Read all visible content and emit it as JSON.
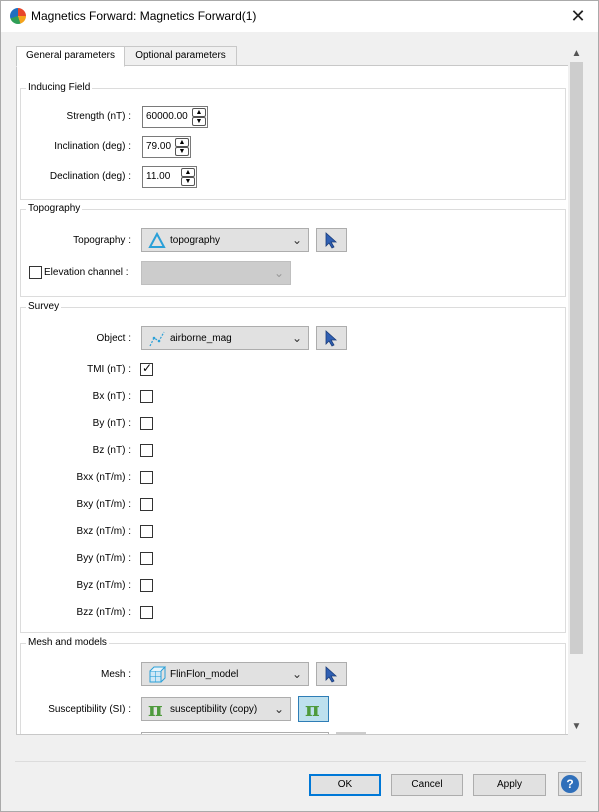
{
  "window": {
    "title": "Magnetics Forward: Magnetics Forward(1)",
    "close_glyph": "✕"
  },
  "tabs": [
    {
      "label": "General parameters",
      "active": true
    },
    {
      "label": "Optional parameters",
      "active": false
    }
  ],
  "inducing_field": {
    "title": "Inducing Field",
    "strength_label": "Strength (nT) :",
    "strength_value": "60000.00",
    "inclination_label": "Inclination (deg) :",
    "inclination_value": "79.00",
    "declination_label": "Declination (deg) :",
    "declination_value": "11.00"
  },
  "topography": {
    "title": "Topography",
    "topography_label": "Topography :",
    "topography_value": "topography",
    "elevation_label": "Elevation channel :",
    "elevation_checked": false,
    "elevation_value": ""
  },
  "survey": {
    "title": "Survey",
    "object_label": "Object :",
    "object_value": "airborne_mag",
    "components": [
      {
        "label": "TMI (nT) :",
        "checked": true
      },
      {
        "label": "Bx (nT) :",
        "checked": false
      },
      {
        "label": "By (nT) :",
        "checked": false
      },
      {
        "label": "Bz (nT) :",
        "checked": false
      },
      {
        "label": "Bxx (nT/m) :",
        "checked": false
      },
      {
        "label": "Bxy (nT/m) :",
        "checked": false
      },
      {
        "label": "Bxz (nT/m) :",
        "checked": false
      },
      {
        "label": "Byy (nT/m) :",
        "checked": false
      },
      {
        "label": "Byz (nT/m) :",
        "checked": false
      },
      {
        "label": "Bzz (nT/m) :",
        "checked": false
      }
    ]
  },
  "mesh": {
    "title": "Mesh and models",
    "mesh_label": "Mesh :",
    "mesh_value": "FlinFlon_model",
    "susceptibility_label": "Susceptibility (SI) :",
    "susceptibility_value": "susceptibility (copy)",
    "pi_glyph": "π"
  },
  "footer": {
    "ok_label": "OK",
    "cancel_label": "Cancel",
    "apply_label": "Apply",
    "help_glyph": "?"
  },
  "colors": {
    "accent": "#0078d7",
    "pi_green": "#4e9a3c",
    "panel_bg": "#ffffff",
    "dialog_bg": "#f0f0f0"
  }
}
